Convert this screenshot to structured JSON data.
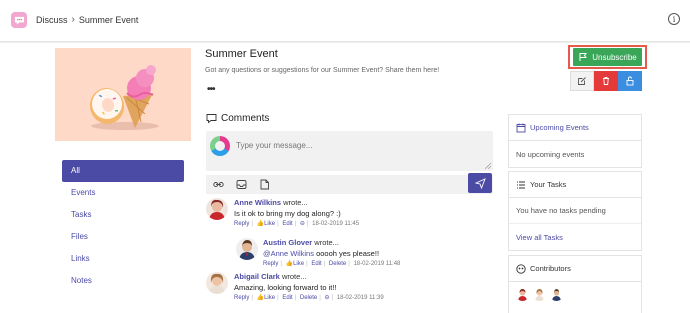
{
  "header": {
    "breadcrumb_root": "Discuss",
    "breadcrumb_separator": "›",
    "breadcrumb_current": "Summer Event",
    "info_icon": "info-circle-icon"
  },
  "nav": {
    "items": [
      {
        "label": "All",
        "active": true
      },
      {
        "label": "Events",
        "active": false
      },
      {
        "label": "Tasks",
        "active": false
      },
      {
        "label": "Files",
        "active": false
      },
      {
        "label": "Links",
        "active": false
      },
      {
        "label": "Notes",
        "active": false
      }
    ]
  },
  "topic": {
    "title": "Summer Event",
    "subtitle": "Got any questions or suggestions for our Summer Event? Share them here!",
    "more": "•••",
    "unsubscribe_label": "Unsubscribe"
  },
  "comments": {
    "heading": "Comments",
    "placeholder": "Type your message...",
    "list": [
      {
        "author": "Anne Wilkins",
        "verb": "wrote...",
        "text": "Is it ok to bring my dog along? :)",
        "mention": "",
        "actions": [
          "Reply",
          "Like",
          "Edit"
        ],
        "date": "18-02-2019 11:45"
      },
      {
        "author": "Austin Glover",
        "verb": "wrote...",
        "mention": "@Anne Wilkins",
        "text": "ooooh yes please!!",
        "actions": [
          "Reply",
          "Like",
          "Edit",
          "Delete"
        ],
        "date": "18-02-2019 11:48"
      },
      {
        "author": "Abigail Clark",
        "verb": "wrote...",
        "mention": "",
        "text": "Amazing, looking forward to it!!",
        "actions": [
          "Reply",
          "Like",
          "Edit",
          "Delete"
        ],
        "date": "18-02-2019 11:39"
      }
    ]
  },
  "sidebar": {
    "upcoming_title": "Upcoming Events",
    "upcoming_empty": "No upcoming events",
    "tasks_title": "Your Tasks",
    "tasks_empty": "You have no tasks pending",
    "tasks_link": "View all Tasks",
    "contributors_title": "Contributors"
  },
  "colors": {
    "accent": "#4b4aa4",
    "unsubscribe": "#3aa658",
    "delete": "#e53a3a",
    "lock": "#3b8de0",
    "highlight": "#e45a4b"
  }
}
